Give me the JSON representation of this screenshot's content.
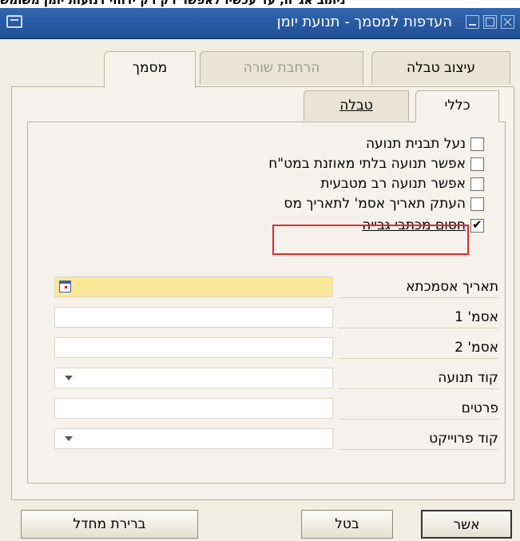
{
  "top_cut_text": "ניתוב אג\"ח, עד עכשיו לאפשר רק רק ידוחי דנועות יומן משומש",
  "window": {
    "title": "העדפות למסמך - תנועת יומן"
  },
  "tabs": [
    {
      "label": "עיצוב טבלה",
      "underline": "צ"
    },
    {
      "label": "הרחבת שורה"
    },
    {
      "label": "מסמך"
    }
  ],
  "subtabs": [
    {
      "label": "כללי"
    },
    {
      "label": "טבלה"
    }
  ],
  "checkboxes": [
    {
      "label": "נעל תבנית תנועה",
      "checked": false
    },
    {
      "label": "אפשר תנועה בלתי מאוזנת במט\"ח",
      "checked": false
    },
    {
      "label": "אפשר תנועה רב מטבעית",
      "checked": false
    },
    {
      "label": "העתק תאריך אסמ' לתאריך מס",
      "checked": false
    },
    {
      "label": "חסום מכתבי גבייה",
      "checked": true
    }
  ],
  "fields": [
    {
      "label": "תאריך אסמכתא",
      "value": ""
    },
    {
      "label": "אסמ' 1",
      "value": ""
    },
    {
      "label": "אסמ' 2",
      "value": ""
    },
    {
      "label": "קוד תנועה",
      "value": ""
    },
    {
      "label": "פרטים",
      "value": ""
    },
    {
      "label": "קוד פרוייקט",
      "value": ""
    }
  ],
  "buttons": {
    "ok": "אשר",
    "cancel": "בטל",
    "reset": "ברירת מחדל"
  },
  "colors": {
    "titlebar": "#2a5aa3",
    "highlight": "#e8262e",
    "date_field": "#fbe89a"
  }
}
